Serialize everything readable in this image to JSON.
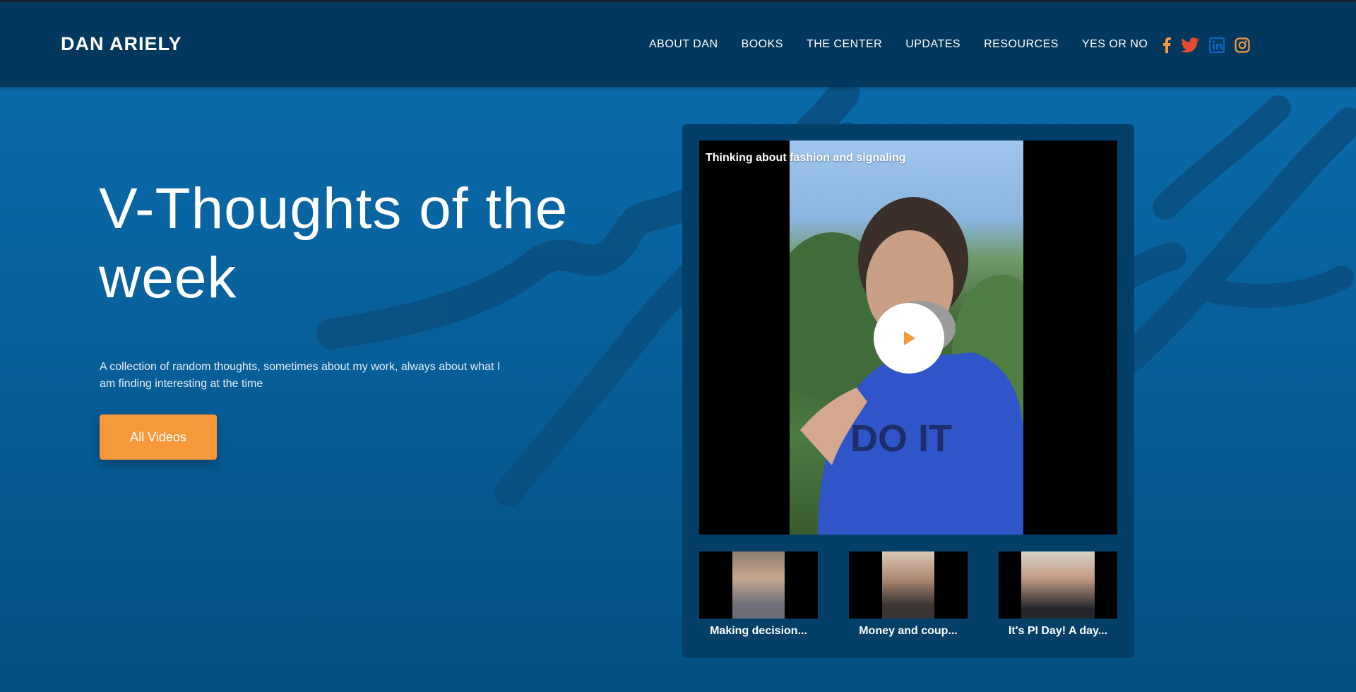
{
  "header": {
    "logo": "DAN ARIELY",
    "nav": [
      "ABOUT DAN",
      "BOOKS",
      "THE CENTER",
      "UPDATES",
      "RESOURCES",
      "YES OR NO"
    ],
    "socials": [
      "facebook-icon",
      "twitter-icon",
      "linkedin-icon",
      "instagram-icon"
    ]
  },
  "hero": {
    "title": "V-Thoughts of the week",
    "description": "A collection of random thoughts, sometimes about my work, always about what I am finding interesting at the time",
    "button_label": "All Videos"
  },
  "video": {
    "title": "Thinking about fashion and signaling",
    "shirt_text": "DO IT"
  },
  "thumbnails": [
    {
      "caption": "Making decision..."
    },
    {
      "caption": "Money and coup..."
    },
    {
      "caption": "It's PI Day! A day..."
    }
  ],
  "colors": {
    "header_bg": "#02375e",
    "accent": "#f7983a",
    "panel_bg": "#033f66",
    "linkedin": "#0a66c2",
    "social_orange": "#f7983a",
    "twitter": "#e84a2f"
  }
}
